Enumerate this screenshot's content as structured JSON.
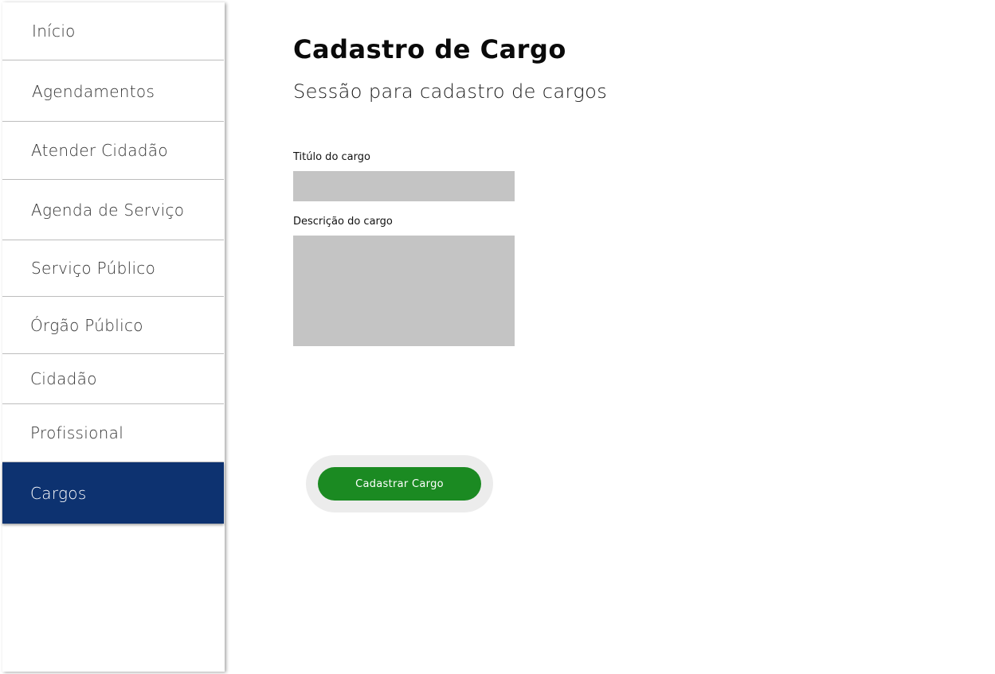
{
  "sidebar": {
    "items": [
      {
        "label": "Início",
        "active": false
      },
      {
        "label": "Agendamentos",
        "active": false
      },
      {
        "label": "Atender Cidadão",
        "active": false
      },
      {
        "label": "Agenda de Serviço",
        "active": false
      },
      {
        "label": "Serviço Público",
        "active": false
      },
      {
        "label": "Órgão Público",
        "active": false
      },
      {
        "label": "Cidadão",
        "active": false
      },
      {
        "label": "Profissional",
        "active": false
      },
      {
        "label": "Cargos",
        "active": true
      }
    ]
  },
  "main": {
    "title": "Cadastro de Cargo",
    "subtitle": "Sessão para cadastro de cargos",
    "form": {
      "title_field": {
        "label": "Titúlo do cargo",
        "value": ""
      },
      "description_field": {
        "label": "Descrição do cargo",
        "value": ""
      },
      "submit_label": "Cadastrar Cargo"
    }
  },
  "colors": {
    "active_nav_bg": "#0d3270",
    "button_bg": "#1b8a22",
    "input_bg": "#c4c4c4"
  }
}
